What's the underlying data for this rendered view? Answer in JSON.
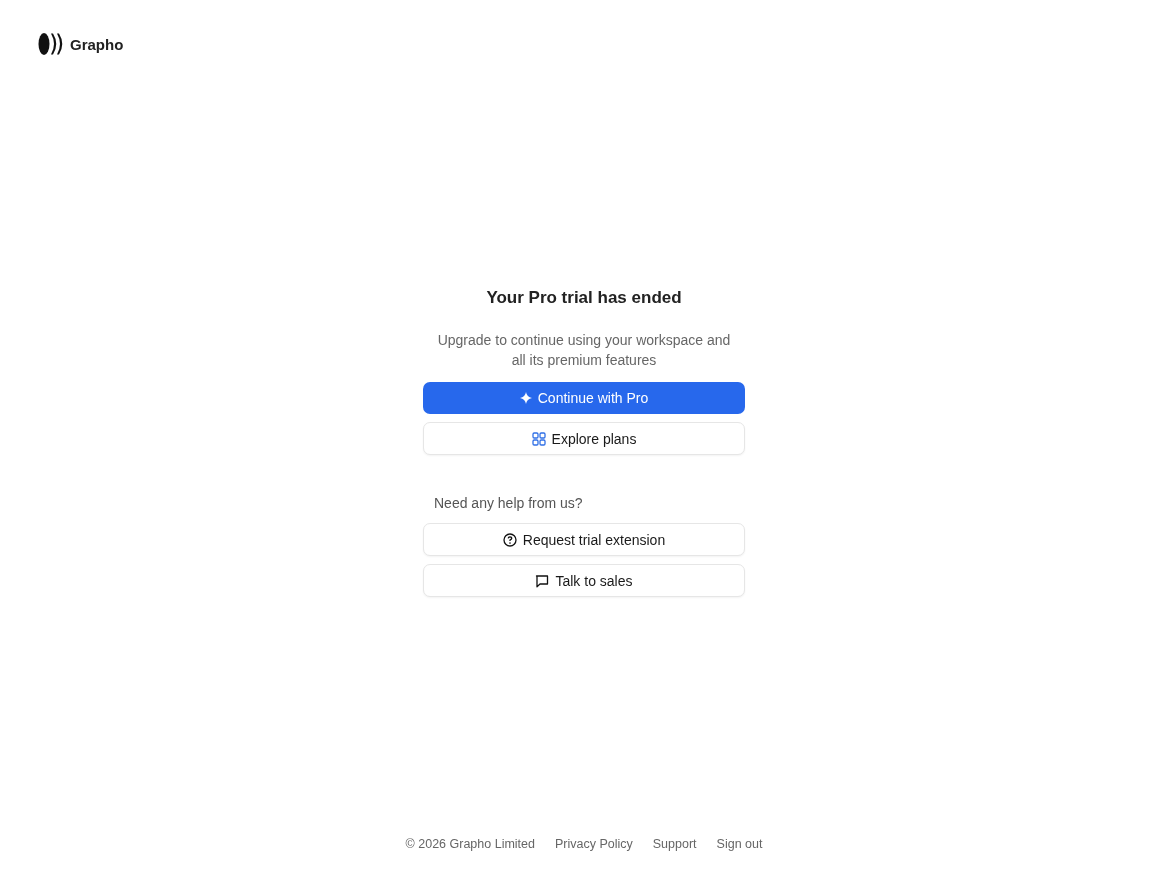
{
  "brand": {
    "name": "Grapho"
  },
  "dialog": {
    "title": "Your Pro trial has ended",
    "message": "Upgrade to continue using your workspace and all its premium features",
    "actions": [
      {
        "label": "Continue with Pro",
        "kind": "upgrade"
      },
      {
        "label": "Explore plans",
        "kind": "plans"
      }
    ],
    "help_label": "Need any help from us?",
    "help_actions": [
      {
        "label": "Request trial extension",
        "kind": "help"
      },
      {
        "label": "Talk to sales",
        "kind": "sales"
      }
    ]
  },
  "footer": {
    "copyright": "© 2026 Grapho Limited",
    "links": [
      "Privacy Policy",
      "Support",
      "Sign out"
    ]
  }
}
